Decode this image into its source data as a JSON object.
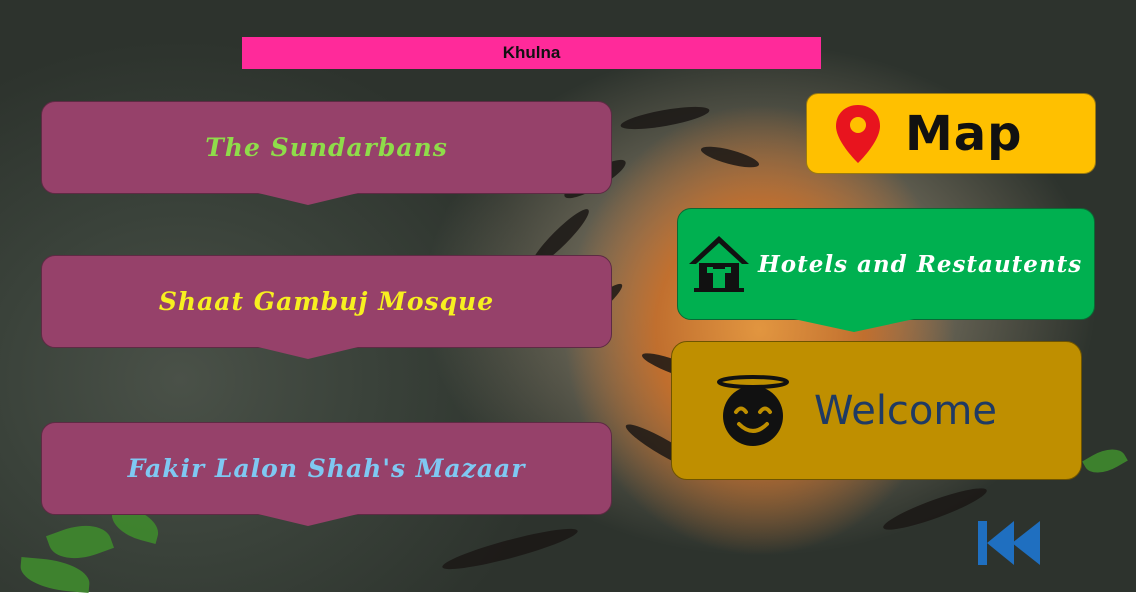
{
  "header": {
    "title": "Khulna"
  },
  "places": [
    {
      "label": "The Sundarbans"
    },
    {
      "label": "Shaat Gambuj Mosque"
    },
    {
      "label": "Fakir Lalon Shah's Mazaar"
    }
  ],
  "actions": {
    "map_label": "Map",
    "hotels_label": "Hotels and Restautents",
    "welcome_label": "Welcome"
  },
  "icons": {
    "map": "map-pin-icon",
    "hotels": "house-icon",
    "welcome": "smiling-face-with-halo-icon",
    "back": "skip-back-icon"
  },
  "colors": {
    "title_bar": "#ff2a9a",
    "place_box": "#96416a",
    "map_button": "#ffc000",
    "hotels_button": "#00b050",
    "welcome_button": "#bf8f00",
    "back_icon": "#1f6fc0"
  }
}
